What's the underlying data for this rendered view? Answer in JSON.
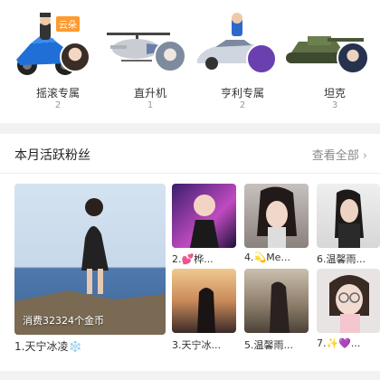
{
  "gifts": [
    {
      "label": "摇滚专属",
      "count": "2",
      "badge": "云朵",
      "art": "motorcycle-gift-icon"
    },
    {
      "label": "直升机",
      "count": "1",
      "art": "helicopter-gift-icon"
    },
    {
      "label": "亨利专属",
      "count": "2",
      "art": "sportscar-gift-icon"
    },
    {
      "label": "坦克",
      "count": "3",
      "art": "tank-gift-icon"
    }
  ],
  "fans_section": {
    "title": "本月活跃粉丝",
    "view_all": "查看全部",
    "chevron": "›",
    "top_fan": {
      "name": "1.天宁冰凌❄️",
      "spent": "消费32324个金币"
    },
    "fans": [
      {
        "name": "2.💕桦..."
      },
      {
        "name": "4.💫Me..."
      },
      {
        "name": "6.温馨雨..."
      },
      {
        "name": "3.天宁冰..."
      },
      {
        "name": "5.温馨雨..."
      },
      {
        "name": "7.✨💜..."
      }
    ]
  }
}
